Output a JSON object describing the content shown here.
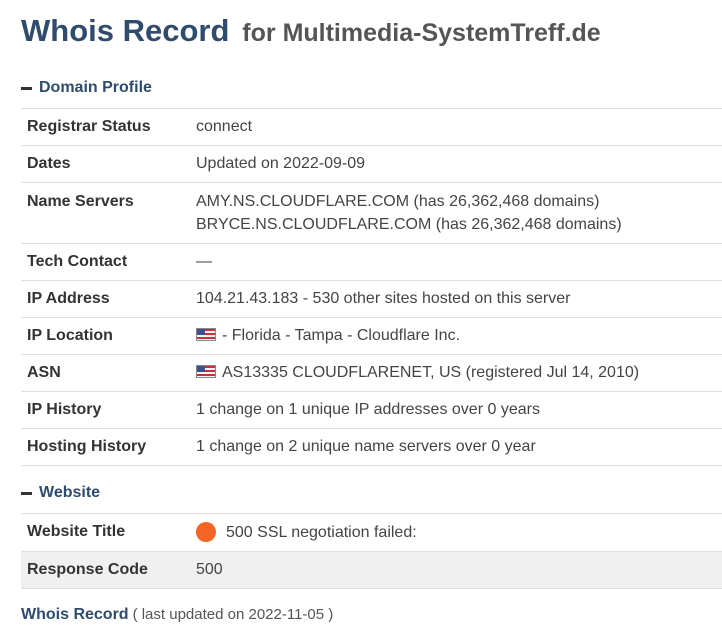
{
  "header": {
    "title": "Whois Record",
    "subtitle": "for Multimedia-SystemTreff.de"
  },
  "domain_profile": {
    "heading": "Domain Profile",
    "rows": [
      {
        "label": "Registrar Status",
        "value": "connect"
      },
      {
        "label": "Dates",
        "value": "Updated on 2022-09-09"
      },
      {
        "label": "Name Servers",
        "lines": [
          "AMY.NS.CLOUDFLARE.COM (has 26,362,468 domains)",
          "BRYCE.NS.CLOUDFLARE.COM (has 26,362,468 domains)"
        ]
      },
      {
        "label": "Tech Contact",
        "value": "—"
      },
      {
        "label": "IP Address",
        "value": "104.21.43.183 - 530 other sites hosted on this server"
      },
      {
        "label": "IP Location",
        "value": "- Florida - Tampa - Cloudflare Inc.",
        "icon": "us-flag-icon"
      },
      {
        "label": "ASN",
        "value": "AS13335 CLOUDFLARENET, US (registered Jul 14, 2010)",
        "icon": "us-flag-icon"
      },
      {
        "label": "IP History",
        "value": "1 change on 1 unique IP addresses over 0 years"
      },
      {
        "label": "Hosting History",
        "value": "1 change on 2 unique name servers over 0 year"
      }
    ]
  },
  "website": {
    "heading": "Website",
    "rows": [
      {
        "label": "Website Title",
        "value": "500 SSL negotiation failed:",
        "icon": "status-dot-icon",
        "icon_color": "#f26522"
      },
      {
        "label": "Response Code",
        "value": "500"
      }
    ]
  },
  "footer": {
    "link": "Whois Record",
    "note": "( last updated on 2022-11-05 )"
  },
  "colors": {
    "heading": "#2f4b6d",
    "status_dot": "#f26522",
    "row_shade": "#f0f0f0"
  }
}
